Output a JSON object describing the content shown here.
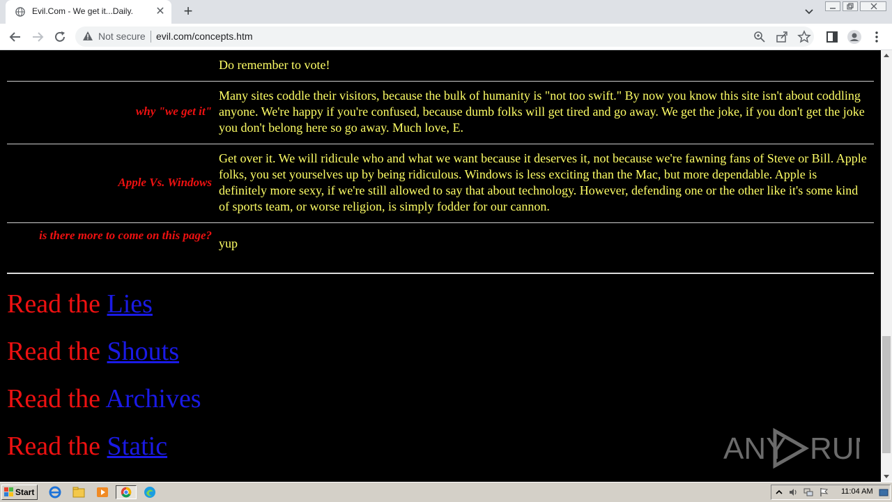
{
  "browser": {
    "tab_title": "Evil.Com - We get it...Daily.",
    "security_label": "Not secure",
    "url": "evil.com/concepts.htm"
  },
  "faq": [
    {
      "label": "",
      "text": "Do remember to vote!"
    },
    {
      "label": "why \"we get it\"",
      "text": "Many sites coddle their visitors, because the bulk of humanity is \"not too swift.\" By now you know this site isn't about coddling anyone. We're happy if you're confused, because dumb folks will get tired and go away.  We get the joke, if you don't get the joke you don't belong here so go away.  Much love, E."
    },
    {
      "label": "Apple Vs. Windows",
      "text": "Get over it.  We will ridicule who and what we want because it deserves it, not because we're fawning fans of Steve or Bill.  Apple folks, you set yourselves up by being ridiculous.  Windows is less exciting than the Mac, but more dependable.  Apple is definitely more sexy, if we're still allowed to say that about technology.   However, defending one or the other like it's some kind of sports team, or worse religion, is simply fodder for our cannon."
    },
    {
      "label": "is there more to come on this page?",
      "text": "yup"
    }
  ],
  "read_links": [
    {
      "prefix": "Read the",
      "link": "Lies"
    },
    {
      "prefix": "Read the",
      "link": "Shouts"
    },
    {
      "prefix": "Read the",
      "link": "Archives"
    },
    {
      "prefix": "Read the",
      "link": "Static"
    }
  ],
  "watermark": "ANY RUN",
  "taskbar": {
    "start_label": "Start",
    "clock": "11:04 AM"
  },
  "colors": {
    "page_bg": "#000000",
    "label_red": "#ee1111",
    "text_yellow": "#ffff66",
    "link_blue": "#1a1ae6"
  }
}
